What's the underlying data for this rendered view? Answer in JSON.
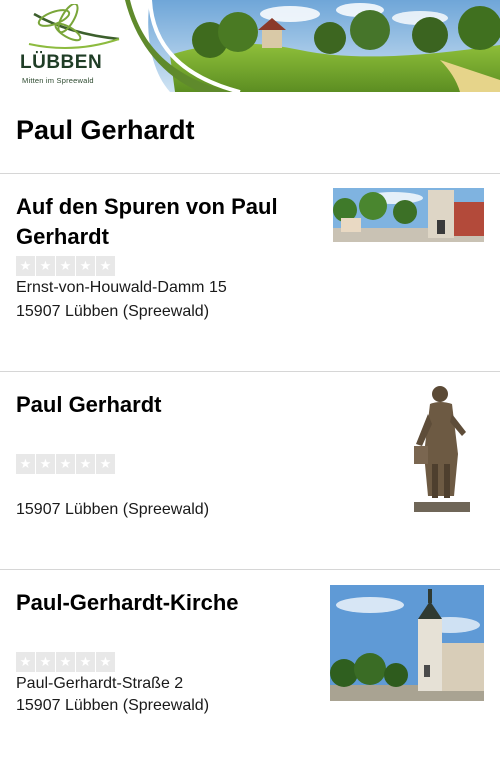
{
  "header": {
    "logo_word": "LÜBBEN",
    "logo_tagline": "Mitten im Spreewald"
  },
  "page_title": "Paul Gerhardt",
  "items": [
    {
      "title": "Auf den Spuren von Paul Gerhardt",
      "rating_stars": 5,
      "rating_value": 0,
      "street": "Ernst-von-Houwald-Damm 15",
      "city": "15907 Lübben (Spreewald)",
      "image": "town-square-church-photo"
    },
    {
      "title": "Paul Gerhardt",
      "rating_stars": 5,
      "rating_value": 0,
      "street": "",
      "city": "15907 Lübben (Spreewald)",
      "image": "statue-photo"
    },
    {
      "title": "Paul-Gerhardt-Kirche",
      "rating_stars": 5,
      "rating_value": 0,
      "street": "Paul-Gerhardt-Straße 2",
      "city": "15907 Lübben (Spreewald)",
      "image": "church-tower-photo"
    }
  ],
  "colors": {
    "divider": "#d6d6d6",
    "banner_green": "#5f8a2c",
    "logo_green": "#1f3d26",
    "star_bg": "#e8e8e8"
  }
}
